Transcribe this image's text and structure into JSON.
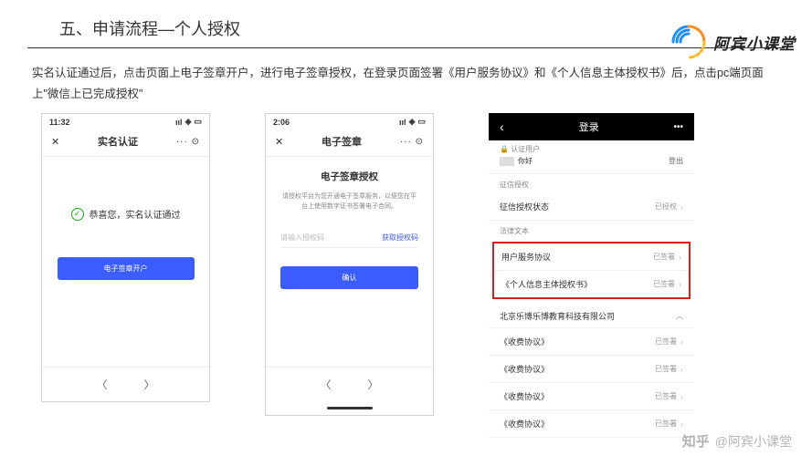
{
  "header": {
    "title": "五、申请流程—个人授权"
  },
  "logo": {
    "text": "阿宾小课堂"
  },
  "description": "实名认证通过后，点击页面上电子签章开户，进行电子签章授权，在登录页面签署《用户服务协议》和《个人信息主体授权书》后，点击pc端页面上\"微信上已完成授权\"",
  "phone1": {
    "time": "11:32",
    "navTitle": "实名认证",
    "successText": "恭喜您，实名认证通过",
    "buttonLabel": "电子签章开户",
    "closeLabel": "✕",
    "dots": "···  ⊙"
  },
  "phone2": {
    "time": "2:06",
    "navTitle": "电子签章",
    "bodyTitle": "电子签章授权",
    "bodyDesc": "请授权平台为您开通电子签章服务，以便您在平台上使用数字证书签署电子合同。",
    "placeholder": "请输入授权码",
    "linkLabel": "获取授权码",
    "buttonLabel": "确认",
    "closeLabel": "✕",
    "dots": "···  ⊙"
  },
  "phone3": {
    "navTitle": "登录",
    "userSection": "认证用户",
    "greeting": "你好",
    "logout": "登出",
    "authSection": "征信授权",
    "rows1": [
      {
        "label": "征信授权状态",
        "status": "已授权"
      }
    ],
    "lawSection": "法律文本",
    "redRows": [
      {
        "label": "用户服务协议",
        "status": "已签署"
      },
      {
        "label": "《个人信息主体授权书》",
        "status": "已签署"
      }
    ],
    "company": "北京乐博乐博教育科技有限公司",
    "feeRows": [
      {
        "label": "《收费协议》",
        "status": "已签署"
      },
      {
        "label": "《收费协议》",
        "status": "已签署"
      },
      {
        "label": "《收费协议》",
        "status": "已签署"
      },
      {
        "label": "《收费协议》",
        "status": "已签署"
      }
    ]
  },
  "watermark": {
    "brand": "知乎",
    "handle": "@阿宾小课堂"
  }
}
